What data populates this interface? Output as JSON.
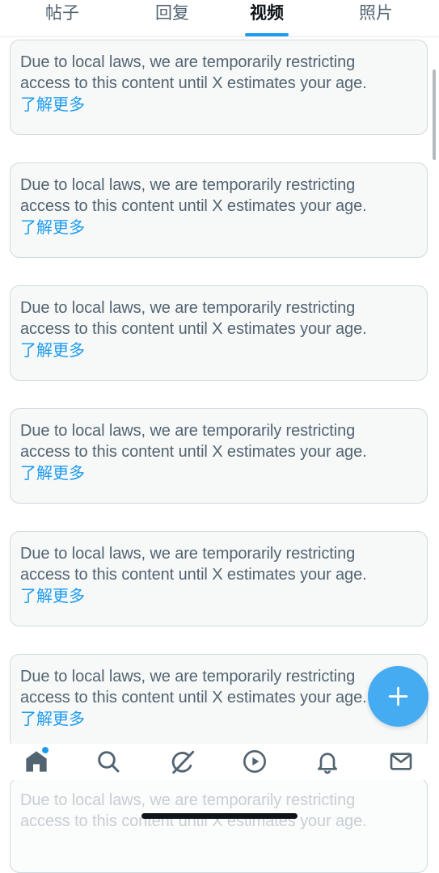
{
  "tabs": [
    {
      "label": "帖子",
      "active": false
    },
    {
      "label": "回复",
      "active": false
    },
    {
      "label": "视频",
      "active": true
    },
    {
      "label": "照片",
      "active": false
    }
  ],
  "cards": [
    {
      "line1": "Due to local laws, we are temporarily restricting",
      "line2": "access to this content until X estimates your age.",
      "link": "了解更多"
    },
    {
      "line1": "Due to local laws, we are temporarily restricting",
      "line2": "access to this content until X estimates your age.",
      "link": "了解更多"
    },
    {
      "line1": "Due to local laws, we are temporarily restricting",
      "line2": "access to this content until X estimates your age.",
      "link": "了解更多"
    },
    {
      "line1": "Due to local laws, we are temporarily restricting",
      "line2": "access to this content until X estimates your age.",
      "link": "了解更多"
    },
    {
      "line1": "Due to local laws, we are temporarily restricting",
      "line2": "access to this content until X estimates your age.",
      "link": "了解更多"
    },
    {
      "line1": "Due to local laws, we are temporarily restricting",
      "line2": "access to this content until X estimates your age.",
      "link": "了解更多"
    },
    {
      "line1": "Due to local laws, we are temporarily restricting",
      "line2": "access to this content until X estimates your age.",
      "link": ""
    }
  ],
  "nav": [
    {
      "icon": "home-icon",
      "active": true,
      "has_dot": true
    },
    {
      "icon": "search-icon"
    },
    {
      "icon": "grok-icon"
    },
    {
      "icon": "video-play-icon"
    },
    {
      "icon": "notifications-bell-icon"
    },
    {
      "icon": "messages-mail-icon"
    }
  ],
  "fab": {
    "icon": "plus-icon"
  },
  "colors": {
    "accent": "#1d9bf0",
    "text_secondary": "#536471",
    "card_bg": "#f7f9f9",
    "card_border": "#cfd9de"
  }
}
